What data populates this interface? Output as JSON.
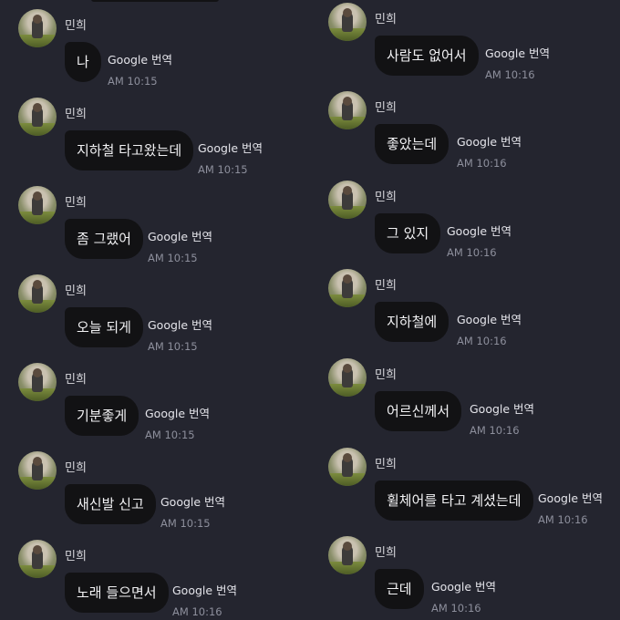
{
  "left_messages": [
    {
      "sender": "민희",
      "text": "나",
      "translate": "Google 번역",
      "time": "AM 10:15"
    },
    {
      "sender": "민희",
      "text": "지하철 타고왔는데",
      "translate": "Google 번역",
      "time": "AM 10:15"
    },
    {
      "sender": "민희",
      "text": "좀 그랬어",
      "translate": "Google 번역",
      "time": "AM 10:15"
    },
    {
      "sender": "민희",
      "text": "오늘 되게",
      "translate": "Google 번역",
      "time": "AM 10:15"
    },
    {
      "sender": "민희",
      "text": "기분좋게",
      "translate": "Google 번역",
      "time": "AM 10:15"
    },
    {
      "sender": "민희",
      "text": "새신발 신고",
      "translate": "Google 번역",
      "time": "AM 10:15"
    },
    {
      "sender": "민희",
      "text": "노래 들으면서",
      "translate": "Google 번역",
      "time": "AM 10:16"
    }
  ],
  "right_messages": [
    {
      "sender": "민희",
      "text": "사람도 없어서",
      "translate": "Google 번역",
      "time": "AM 10:16"
    },
    {
      "sender": "민희",
      "text": "좋았는데",
      "translate": "Google 번역",
      "time": "AM 10:16"
    },
    {
      "sender": "민희",
      "text": "그 있지",
      "translate": "Google 번역",
      "time": "AM 10:16"
    },
    {
      "sender": "민희",
      "text": "지하철에",
      "translate": "Google 번역",
      "time": "AM 10:16"
    },
    {
      "sender": "민희",
      "text": "어르신께서",
      "translate": "Google 번역",
      "time": "AM 10:16"
    },
    {
      "sender": "민희",
      "text": "휠체어를 타고 계셨는데",
      "translate": "Google 번역",
      "time": "AM 10:16"
    },
    {
      "sender": "민희",
      "text": "근데",
      "translate": "Google 번역",
      "time": "AM 10:16"
    }
  ],
  "colors": {
    "background": "#24252f",
    "bubble": "#121214",
    "time": "#8d8f9c"
  },
  "icons": {
    "avatar": "profile-photo-avatar"
  }
}
